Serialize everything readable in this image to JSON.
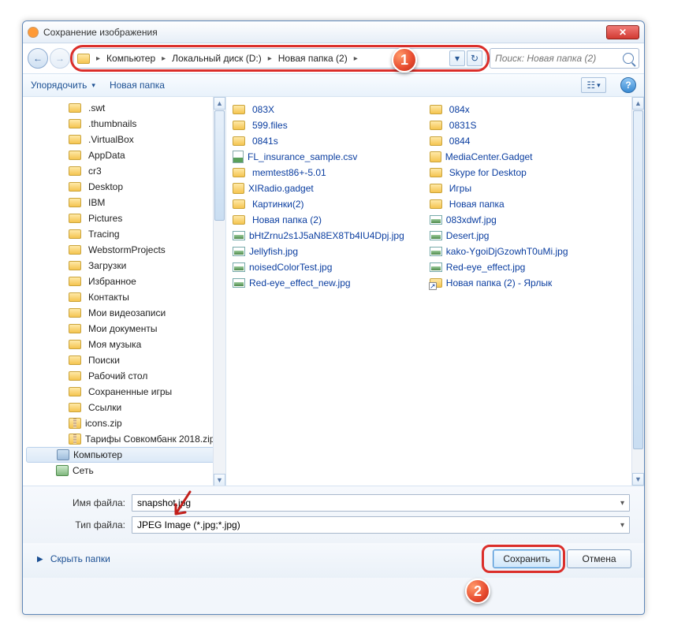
{
  "window": {
    "title": "Сохранение изображения",
    "close": "✕"
  },
  "nav": {
    "back": "←",
    "forward": "→",
    "crumbs": [
      "Компьютер",
      "Локальный диск (D:)",
      "Новая папка (2)"
    ],
    "refresh": "↻",
    "dropdown": "▾"
  },
  "search": {
    "placeholder": "Поиск: Новая папка (2)"
  },
  "toolbar": {
    "organize": "Упорядочить",
    "newfolder": "Новая папка",
    "view": "☷",
    "help": "?"
  },
  "tree": [
    {
      "label": ".swt",
      "icon": "folder"
    },
    {
      "label": ".thumbnails",
      "icon": "folder"
    },
    {
      "label": ".VirtualBox",
      "icon": "folder"
    },
    {
      "label": "AppData",
      "icon": "folder"
    },
    {
      "label": "cr3",
      "icon": "folder"
    },
    {
      "label": "Desktop",
      "icon": "folder"
    },
    {
      "label": "IBM",
      "icon": "folder"
    },
    {
      "label": "Pictures",
      "icon": "folder"
    },
    {
      "label": "Tracing",
      "icon": "folder"
    },
    {
      "label": "WebstormProjects",
      "icon": "folder"
    },
    {
      "label": "Загрузки",
      "icon": "folder"
    },
    {
      "label": "Избранное",
      "icon": "folder"
    },
    {
      "label": "Контакты",
      "icon": "folder"
    },
    {
      "label": "Мои видеозаписи",
      "icon": "folder"
    },
    {
      "label": "Мои документы",
      "icon": "folder"
    },
    {
      "label": "Моя музыка",
      "icon": "folder"
    },
    {
      "label": "Поиски",
      "icon": "folder"
    },
    {
      "label": "Рабочий стол",
      "icon": "folder"
    },
    {
      "label": "Сохраненные игры",
      "icon": "folder"
    },
    {
      "label": "Ссылки",
      "icon": "folder"
    },
    {
      "label": "icons.zip",
      "icon": "zip"
    },
    {
      "label": "Тарифы Совкомбанк 2018.zip",
      "icon": "zip"
    }
  ],
  "tree_roots": [
    {
      "label": "Компьютер",
      "icon": "comp",
      "selected": true
    },
    {
      "label": "Сеть",
      "icon": "net"
    }
  ],
  "files_col1": [
    {
      "label": "083X",
      "icon": "folder"
    },
    {
      "label": "599.files",
      "icon": "folder"
    },
    {
      "label": "0841s",
      "icon": "folder"
    },
    {
      "label": "FL_insurance_sample.csv",
      "icon": "csv"
    },
    {
      "label": "memtest86+-5.01",
      "icon": "folder"
    },
    {
      "label": "XIRadio.gadget",
      "icon": "gadget"
    },
    {
      "label": "Картинки(2)",
      "icon": "folder"
    },
    {
      "label": "Новая папка (2)",
      "icon": "folder"
    },
    {
      "label": "bHtZrnu2s1J5aN8EX8Tb4IU4Dpj.jpg",
      "icon": "img"
    },
    {
      "label": "Jellyfish.jpg",
      "icon": "img"
    },
    {
      "label": "noisedColorTest.jpg",
      "icon": "img"
    },
    {
      "label": "Red-eye_effect_new.jpg",
      "icon": "img"
    }
  ],
  "files_col2": [
    {
      "label": "084x",
      "icon": "folder"
    },
    {
      "label": "0831S",
      "icon": "folder"
    },
    {
      "label": "0844",
      "icon": "folder"
    },
    {
      "label": "MediaCenter.Gadget",
      "icon": "gadget"
    },
    {
      "label": "Skype for Desktop",
      "icon": "folder"
    },
    {
      "label": "Игры",
      "icon": "folder"
    },
    {
      "label": "Новая папка",
      "icon": "folder"
    },
    {
      "label": "083xdwf.jpg",
      "icon": "img"
    },
    {
      "label": "Desert.jpg",
      "icon": "img"
    },
    {
      "label": "kako-YgoiDjGzowhT0uMi.jpg",
      "icon": "img"
    },
    {
      "label": "Red-eye_effect.jpg",
      "icon": "img"
    },
    {
      "label": "Новая папка (2) - Ярлык",
      "icon": "shortcut"
    }
  ],
  "form": {
    "filename_label": "Имя файла:",
    "filename_value": "snapshot.jpg",
    "filetype_label": "Тип файла:",
    "filetype_value": "JPEG Image (*.jpg;*.jpg)"
  },
  "actions": {
    "hide_folders": "Скрыть папки",
    "save": "Сохранить",
    "cancel": "Отмена"
  },
  "badges": {
    "one": "1",
    "two": "2"
  }
}
